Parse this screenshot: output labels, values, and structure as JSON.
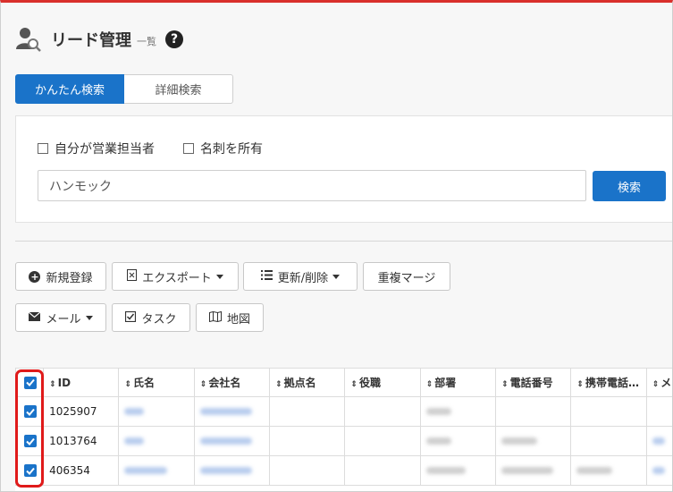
{
  "header": {
    "title": "リード管理",
    "subtitle": "一覧",
    "help_glyph": "?"
  },
  "tabs": [
    {
      "label": "かんたん検索",
      "active": true
    },
    {
      "label": "詳細検索",
      "active": false
    }
  ],
  "filters": {
    "owner_checkbox_label": "自分が営業担当者",
    "card_checkbox_label": "名刺を所有",
    "search_value": "ハンモック",
    "search_button": "検索"
  },
  "toolbar": {
    "new_label": "新規登録",
    "export_label": "エクスポート",
    "update_delete_label": "更新/削除",
    "merge_label": "重複マージ",
    "mail_label": "メール",
    "task_label": "タスク",
    "map_label": "地図"
  },
  "table": {
    "sort_glyph": "⇕",
    "columns": [
      "ID",
      "氏名",
      "会社名",
      "拠点名",
      "役職",
      "部署",
      "電話番号",
      "携帯電話…",
      "メ"
    ],
    "rows": [
      {
        "id": "1025907",
        "checked": true
      },
      {
        "id": "1013764",
        "checked": true
      },
      {
        "id": "406354",
        "checked": true
      }
    ]
  },
  "colors": {
    "accent": "#1a73c9",
    "top_bar": "#d9302c",
    "highlight": "#e01a1a"
  }
}
